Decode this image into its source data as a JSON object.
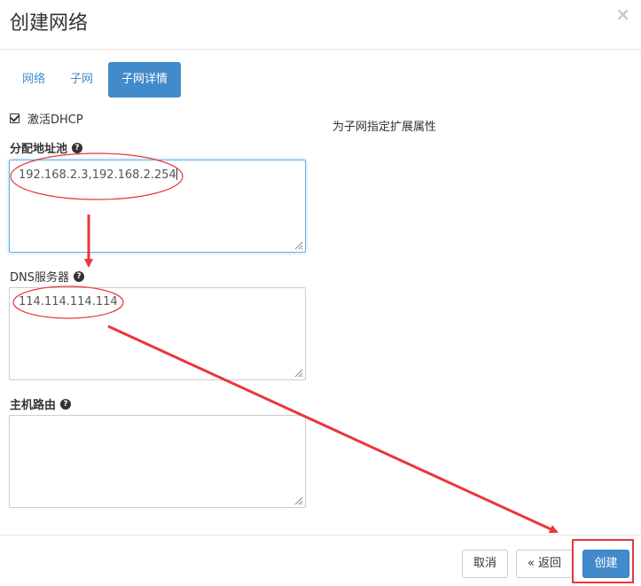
{
  "dialog": {
    "title": "创建网络",
    "close_symbol": "×"
  },
  "tabs": [
    {
      "label": "网络",
      "active": false
    },
    {
      "label": "子网",
      "active": false
    },
    {
      "label": "子网详情",
      "active": true
    }
  ],
  "dhcp": {
    "label": "激活DHCP",
    "checked": true
  },
  "side_help": "为子网指定扩展属性",
  "fields": {
    "allocation_pools": {
      "label": "分配地址池",
      "value": "192.168.2.3,192.168.2.254"
    },
    "dns_servers": {
      "label": "DNS服务器",
      "value": "114.114.114.114"
    },
    "host_routes": {
      "label": "主机路由",
      "value": ""
    }
  },
  "help_symbol": "?",
  "footer": {
    "cancel_label": "取消",
    "back_label": "« 返回",
    "create_label": "创建"
  },
  "colors": {
    "accent": "#428bca",
    "annotation": "#e8373d"
  }
}
